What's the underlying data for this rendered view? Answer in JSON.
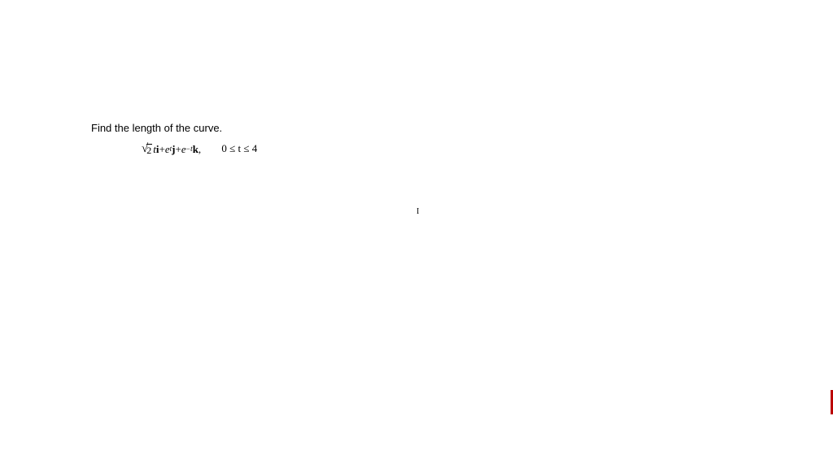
{
  "problem": {
    "prompt": "Find the length of the curve.",
    "expr": {
      "sqrt_value": "2",
      "term1_var": "t",
      "vec_i": "i",
      "plus1": " + ",
      "term2_base": "e",
      "term2_exp": "t",
      "vec_j": "j",
      "plus2": " + ",
      "term3_base": "e",
      "term3_exp_neg": "−",
      "term3_exp": "t",
      "vec_k": "k",
      "comma": ","
    },
    "domain": "0 ≤ t ≤ 4"
  },
  "cursor_mark": "I"
}
